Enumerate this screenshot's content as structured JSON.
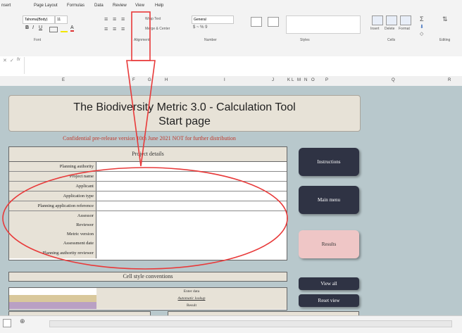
{
  "ribbon": {
    "menu": [
      "nsert",
      "Page Layout",
      "Formulas",
      "Data",
      "Review",
      "View",
      "Help"
    ],
    "font_name": "Tahoma(Body)",
    "font_size": "11",
    "groups": [
      "Font",
      "Alignment",
      "Number",
      "Styles",
      "Cells",
      "Editing"
    ],
    "wrap_text": "Wrap Text",
    "merge_center": "Merge & Center",
    "number_format": "General",
    "insert": "Insert",
    "delete": "Delete",
    "format": "Format"
  },
  "formula_bar": {
    "fx": "fx"
  },
  "columns": [
    "E",
    "F",
    "G",
    "H",
    "I",
    "J",
    "K",
    "L",
    "M",
    "N",
    "O",
    "P",
    "Q",
    "R"
  ],
  "sheet": {
    "title_line1": "The Biodiversity Metric 3.0 - Calculation Tool",
    "title_line2": "Start page",
    "confidential": "Confidential pre-release version 10th June 2021 NOT for further distribution",
    "project_header": "Project details",
    "fields": [
      "Planning authority",
      "Project name",
      "Applicant",
      "Application type",
      "Planning application reference",
      "Assessor",
      "Reviewer",
      "Metric version",
      "Assessment date",
      "Planning authority reviewer"
    ],
    "buttons": {
      "instructions": "Instructions",
      "main_menu": "Main menu",
      "results": "Results",
      "view_all": "View all",
      "reset_view": "Reset view"
    },
    "cell_style_header": "Cell style conventions",
    "styles": [
      "Enter data",
      "Automatic lookup",
      "Result"
    ]
  },
  "colors": {
    "sheet_bg": "#b8c8cc",
    "label_fill": "#e7e2d7",
    "dark_button": "#2f3344",
    "results_button": "#efc6c6",
    "annotation": "#e83a3a"
  }
}
